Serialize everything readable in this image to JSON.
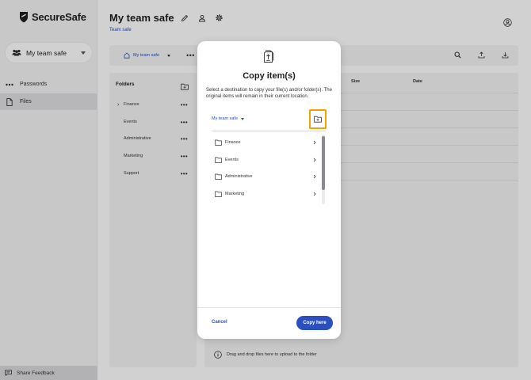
{
  "app": {
    "name": "SecureSafe"
  },
  "sidebar": {
    "safe_selector": "My team safe",
    "items": [
      {
        "label": "Passwords",
        "icon": "password-dots-icon"
      },
      {
        "label": "Files",
        "icon": "file-icon"
      }
    ],
    "feedback_label": "Share Feedback"
  },
  "header": {
    "title": "My team safe",
    "breadcrumb": "Team safe"
  },
  "toolbar": {
    "location_label": "My team safe"
  },
  "folders": {
    "title": "Folders",
    "items": [
      {
        "name": "Finance",
        "expandable": true
      },
      {
        "name": "Events",
        "expandable": false
      },
      {
        "name": "Administrative",
        "expandable": false
      },
      {
        "name": "Marketing",
        "expandable": false
      },
      {
        "name": "Support",
        "expandable": false
      }
    ]
  },
  "files": {
    "columns": [
      "Size",
      "Date"
    ],
    "drop_hint": "Drag and drop files here to upload to the folder"
  },
  "dialog": {
    "title": "Copy item(s)",
    "description": "Select a destination to copy your file(s) and/or folder(s). The original items will remain in their current location.",
    "location": "My team safe",
    "destinations": [
      "Finance",
      "Events",
      "Administrative",
      "Marketing"
    ],
    "cancel_label": "Cancel",
    "confirm_label": "Copy here"
  },
  "colors": {
    "accent": "#2b4fbf",
    "highlight": "#f5a000",
    "sidebar_bg": "#f4f4f5"
  }
}
